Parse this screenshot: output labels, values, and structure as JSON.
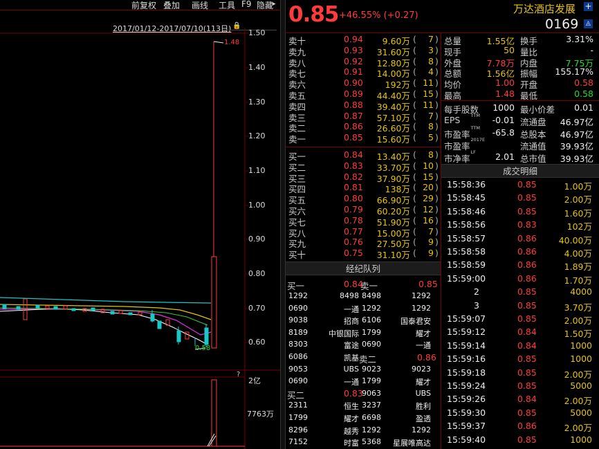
{
  "toolbar": {
    "items": [
      "前复权",
      "叠加",
      "画线",
      "工具",
      "F9",
      "隐藏"
    ]
  },
  "chart": {
    "date_range": "2017/01/12-2017/07/10(113日)",
    "price_ticks": [
      "1.50",
      "1.40",
      "1.30",
      "1.20",
      "1.10",
      "1.00",
      "0.90",
      "0.80",
      "0.70",
      "0.60"
    ],
    "high_label": "1.48",
    "low_label": "0.58",
    "vol_ticks": [
      "2亿",
      "7763万"
    ],
    "vol_question": "?"
  },
  "header": {
    "price": "0.85",
    "change": "+46.55% (+0.27)",
    "name": "万达酒店发展",
    "code": "0169"
  },
  "asks": [
    {
      "label": "卖十",
      "price": "0.94",
      "vol": "9.60万",
      "cnt": "7"
    },
    {
      "label": "卖九",
      "price": "0.93",
      "vol": "31.60万",
      "cnt": "3"
    },
    {
      "label": "卖八",
      "price": "0.92",
      "vol": "12.80万",
      "cnt": "8"
    },
    {
      "label": "卖七",
      "price": "0.91",
      "vol": "14.00万",
      "cnt": "4"
    },
    {
      "label": "卖六",
      "price": "0.90",
      "vol": "192万",
      "cnt": "11"
    },
    {
      "label": "卖五",
      "price": "0.89",
      "vol": "44.40万",
      "cnt": "15"
    },
    {
      "label": "卖四",
      "price": "0.88",
      "vol": "39.40万",
      "cnt": "11"
    },
    {
      "label": "卖三",
      "price": "0.87",
      "vol": "57.10万",
      "cnt": "7"
    },
    {
      "label": "卖二",
      "price": "0.86",
      "vol": "26.60万",
      "cnt": "8"
    },
    {
      "label": "卖一",
      "price": "0.85",
      "vol": "15.60万",
      "cnt": "5"
    }
  ],
  "bids": [
    {
      "label": "买一",
      "price": "0.84",
      "vol": "13.40万",
      "cnt": "8"
    },
    {
      "label": "买二",
      "price": "0.83",
      "vol": "33.70万",
      "cnt": "10"
    },
    {
      "label": "买三",
      "price": "0.82",
      "vol": "37.90万",
      "cnt": "15"
    },
    {
      "label": "买四",
      "price": "0.81",
      "vol": "138万",
      "cnt": "20"
    },
    {
      "label": "买五",
      "price": "0.80",
      "vol": "66.90万",
      "cnt": "29"
    },
    {
      "label": "买六",
      "price": "0.79",
      "vol": "60.20万",
      "cnt": "12"
    },
    {
      "label": "买七",
      "price": "0.78",
      "vol": "51.90万",
      "cnt": "16"
    },
    {
      "label": "买八",
      "price": "0.77",
      "vol": "15.00万",
      "cnt": "7"
    },
    {
      "label": "买九",
      "price": "0.76",
      "vol": "27.50万",
      "cnt": "9"
    },
    {
      "label": "买十",
      "price": "0.75",
      "vol": "31.10万",
      "cnt": "9"
    }
  ],
  "broker": {
    "title": "经纪队列",
    "buy_label": "买一",
    "buy_price": "0.84",
    "sell_label": "卖一",
    "sell_price": "0.85",
    "buy2_label": "买二",
    "buy2_price": "0.83",
    "sell2_label": "卖二",
    "sell2_price": "0.86",
    "rows": [
      [
        "1292",
        "8498",
        "8498",
        "1292"
      ],
      [
        "0690",
        "一通",
        "1292",
        "1292"
      ],
      [
        "9038",
        "招商",
        "6106",
        "国泰君安"
      ],
      [
        "8189",
        "中银国际",
        "1799",
        "耀才"
      ],
      [
        "8303",
        "富途",
        "0690",
        "一通"
      ],
      [
        "6086",
        "凯基",
        "",
        ""
      ],
      [
        "9053",
        "UBS",
        "9023",
        "9023"
      ],
      [
        "0690",
        "一通",
        "1799",
        "耀才"
      ],
      [
        "",
        "",
        "9063",
        "UBS"
      ],
      [
        "2311",
        "恒生",
        "3237",
        "胜利"
      ],
      [
        "1799",
        "耀才",
        "6698",
        "盈透"
      ],
      [
        "8296",
        "越秀",
        "1292",
        "1292"
      ],
      [
        "7152",
        "时富",
        "5368",
        "星展唯高达"
      ]
    ]
  },
  "stats": [
    {
      "l1": "总量",
      "v1": "1.55亿",
      "l2": "换手",
      "v2": "3.31%"
    },
    {
      "l1": "现手",
      "v1": "50",
      "l2": "量比",
      "v2": "-"
    },
    {
      "l1": "外盘",
      "v1": "7.78万",
      "l2": "内盘",
      "v2": "7.75万"
    },
    {
      "l1": "总额",
      "v1": "1.56亿",
      "l2": "振幅",
      "v2": "155.17%"
    },
    {
      "l1": "均价",
      "v1": "1.00",
      "l2": "开盘",
      "v2": "0.58"
    },
    {
      "l1": "最高",
      "v1": "1.48",
      "l2": "最低",
      "v2": "0.58"
    }
  ],
  "fund": [
    {
      "l1": "每手股数",
      "v1": "1000",
      "l2": "最小价差",
      "v2": "0.01"
    },
    {
      "l1": "EPS",
      "s1": "TTM",
      "v1": "-0.01",
      "l2": "流通盘",
      "v2": "46.97亿"
    },
    {
      "l1": "市盈率",
      "s1": "TTM",
      "v1": "-65.8",
      "l2": "总股本",
      "v2": "46.97亿"
    },
    {
      "l1": "市盈率",
      "s1": "2017E",
      "v1": "",
      "l2": "流通值",
      "v2": "39.93亿"
    },
    {
      "l1": "市净率",
      "s1": "LF",
      "v1": "2.01",
      "l2": "总市值",
      "v2": "39.93亿"
    }
  ],
  "trades_title": "成交明细",
  "trades": [
    [
      "15:58:36",
      "0.85",
      "1.00万"
    ],
    [
      "15:58:45",
      "0.85",
      "2.00万"
    ],
    [
      "15:58:46",
      "0.85",
      "1.60万"
    ],
    [
      "15:58:56",
      "0.83",
      "102万"
    ],
    [
      "15:58:57",
      "0.86",
      "40.00万"
    ],
    [
      "15:58:58",
      "0.86",
      "4.00万"
    ],
    [
      "15:58:59",
      "0.86",
      "1.89万"
    ],
    [
      "15:59:00",
      "0.86",
      "1.70万"
    ],
    [
      "2",
      "0.85",
      "4000"
    ],
    [
      "3",
      "0.85",
      "3.70万"
    ],
    [
      "15:59:07",
      "0.85",
      "2.00万"
    ],
    [
      "15:59:12",
      "0.84",
      "1.50万"
    ],
    [
      "15:59:14",
      "0.84",
      "1000"
    ],
    [
      "15:59:16",
      "0.85",
      "1000"
    ],
    [
      "15:59:18",
      "0.85",
      "2.00万"
    ],
    [
      "15:59:24",
      "0.85",
      "5000"
    ],
    [
      "15:59:26",
      "0.84",
      "2.00万"
    ],
    [
      "15:59:30",
      "0.85",
      "5000"
    ],
    [
      "15:59:37",
      "0.86",
      "2.00万"
    ],
    [
      "15:59:40",
      "0.85",
      "1000"
    ]
  ]
}
